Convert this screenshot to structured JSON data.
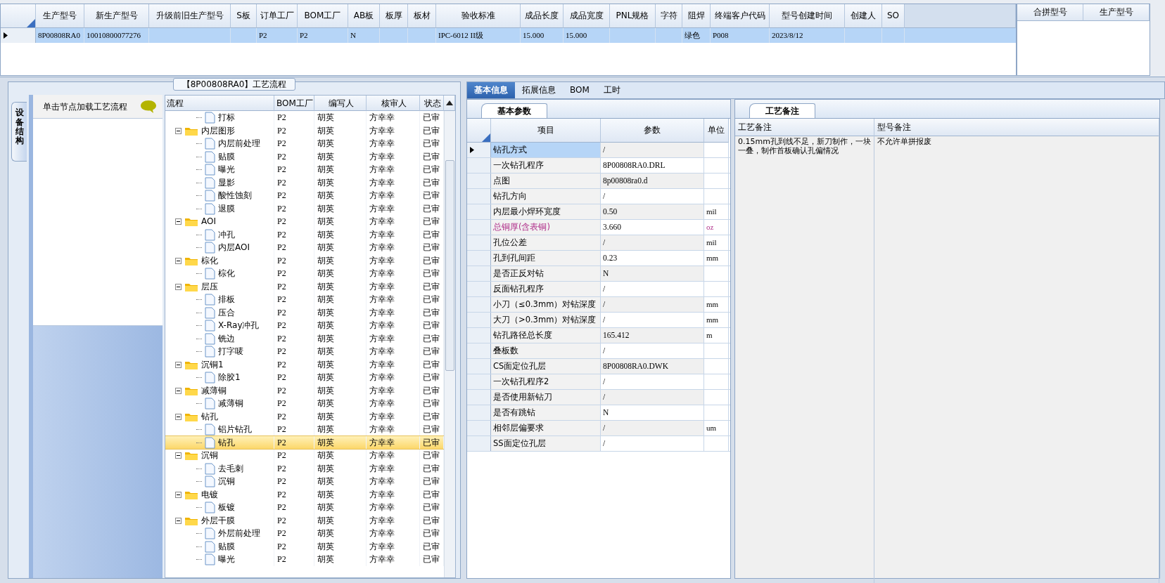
{
  "product_grid": {
    "columns": [
      "生产型号",
      "新生产型号",
      "升级前旧生产型号",
      "S板",
      "订单工厂",
      "BOM工厂",
      "AB板",
      "板厚",
      "板材",
      "验收标准",
      "成品长度",
      "成品宽度",
      "PNL规格",
      "字符",
      "阻焊",
      "终端客户代码",
      "型号创建时间",
      "创建人",
      "SO"
    ],
    "rows": [
      {
        "selected": true,
        "cells": [
          "8P00808RA0",
          "10010800077276",
          null,
          null,
          "P2",
          "P2",
          "N",
          null,
          null,
          "IPC-6012 II级",
          "15.000",
          "15.000",
          null,
          null,
          "绿色",
          "P008",
          "2023/8/12",
          null,
          null
        ]
      }
    ]
  },
  "merge_grid": {
    "columns": [
      "合拼型号",
      "生产型号"
    ]
  },
  "process_panel": {
    "title": "【8P00808RA0】工艺流程",
    "side_tab": "设备结构",
    "hint": "单击节点加载工艺流程",
    "tree": {
      "columns": [
        "流程",
        "BOM工厂",
        "编写人",
        "核审人",
        "状态"
      ],
      "nodes": [
        {
          "kind": "continued",
          "children": [
            {
              "label": "打标",
              "bom": "P2",
              "writer": "胡英",
              "reviewer": "方幸幸",
              "status": "已审",
              "selected": false
            }
          ]
        },
        {
          "kind": "folder",
          "label": "内层图形",
          "bom": "P2",
          "writer": "胡英",
          "reviewer": "方幸幸",
          "status": "已审",
          "selected": false,
          "expanded": true,
          "children": [
            {
              "label": "内层前处理",
              "bom": "P2",
              "writer": "胡英",
              "reviewer": "方幸幸",
              "status": "已审",
              "selected": false
            },
            {
              "label": "贴膜",
              "bom": "P2",
              "writer": "胡英",
              "reviewer": "方幸幸",
              "status": "已审",
              "selected": false
            },
            {
              "label": "曝光",
              "bom": "P2",
              "writer": "胡英",
              "reviewer": "方幸幸",
              "status": "已审",
              "selected": false
            },
            {
              "label": "显影",
              "bom": "P2",
              "writer": "胡英",
              "reviewer": "方幸幸",
              "status": "已审",
              "selected": false
            },
            {
              "label": "酸性蚀刻",
              "bom": "P2",
              "writer": "胡英",
              "reviewer": "方幸幸",
              "status": "已审",
              "selected": false
            },
            {
              "label": "退膜",
              "bom": "P2",
              "writer": "胡英",
              "reviewer": "方幸幸",
              "status": "已审",
              "selected": false
            }
          ]
        },
        {
          "kind": "folder",
          "label": "AOI",
          "bom": "P2",
          "writer": "胡英",
          "reviewer": "方幸幸",
          "status": "已审",
          "selected": false,
          "expanded": true,
          "children": [
            {
              "label": "冲孔",
              "bom": "P2",
              "writer": "胡英",
              "reviewer": "方幸幸",
              "status": "已审",
              "selected": false
            },
            {
              "label": "内层AOI",
              "bom": "P2",
              "writer": "胡英",
              "reviewer": "方幸幸",
              "status": "已审",
              "selected": false
            }
          ]
        },
        {
          "kind": "folder",
          "label": "棕化",
          "bom": "P2",
          "writer": "胡英",
          "reviewer": "方幸幸",
          "status": "已审",
          "selected": false,
          "expanded": true,
          "children": [
            {
              "label": "棕化",
              "bom": "P2",
              "writer": "胡英",
              "reviewer": "方幸幸",
              "status": "已审",
              "selected": false
            }
          ]
        },
        {
          "kind": "folder",
          "label": "层压",
          "bom": "P2",
          "writer": "胡英",
          "reviewer": "方幸幸",
          "status": "已审",
          "selected": false,
          "expanded": true,
          "children": [
            {
              "label": "排板",
              "bom": "P2",
              "writer": "胡英",
              "reviewer": "方幸幸",
              "status": "已审",
              "selected": false
            },
            {
              "label": "压合",
              "bom": "P2",
              "writer": "胡英",
              "reviewer": "方幸幸",
              "status": "已审",
              "selected": false
            },
            {
              "label": "X-Ray冲孔",
              "bom": "P2",
              "writer": "胡英",
              "reviewer": "方幸幸",
              "status": "已审",
              "selected": false
            },
            {
              "label": "铣边",
              "bom": "P2",
              "writer": "胡英",
              "reviewer": "方幸幸",
              "status": "已审",
              "selected": false
            },
            {
              "label": "打字唛",
              "bom": "P2",
              "writer": "胡英",
              "reviewer": "方幸幸",
              "status": "已审",
              "selected": false
            }
          ]
        },
        {
          "kind": "folder",
          "label": "沉铜1",
          "bom": "P2",
          "writer": "胡英",
          "reviewer": "方幸幸",
          "status": "已审",
          "selected": false,
          "expanded": true,
          "children": [
            {
              "label": "除胶1",
              "bom": "P2",
              "writer": "胡英",
              "reviewer": "方幸幸",
              "status": "已审",
              "selected": false
            }
          ]
        },
        {
          "kind": "folder",
          "label": "减薄铜",
          "bom": "P2",
          "writer": "胡英",
          "reviewer": "方幸幸",
          "status": "已审",
          "selected": false,
          "expanded": true,
          "children": [
            {
              "label": "减薄铜",
              "bom": "P2",
              "writer": "胡英",
              "reviewer": "方幸幸",
              "status": "已审",
              "selected": false
            }
          ]
        },
        {
          "kind": "folder",
          "label": "钻孔",
          "bom": "P2",
          "writer": "胡英",
          "reviewer": "方幸幸",
          "status": "已审",
          "selected": false,
          "expanded": true,
          "children": [
            {
              "label": "铝片钻孔",
              "bom": "P2",
              "writer": "胡英",
              "reviewer": "方幸幸",
              "status": "已审",
              "selected": false
            },
            {
              "label": "钻孔",
              "bom": "P2",
              "writer": "胡英",
              "reviewer": "方幸幸",
              "status": "已审",
              "selected": true
            }
          ]
        },
        {
          "kind": "folder",
          "label": "沉铜",
          "bom": "P2",
          "writer": "胡英",
          "reviewer": "方幸幸",
          "status": "已审",
          "selected": false,
          "expanded": true,
          "children": [
            {
              "label": "去毛刺",
              "bom": "P2",
              "writer": "胡英",
              "reviewer": "方幸幸",
              "status": "已审",
              "selected": false
            },
            {
              "label": "沉铜",
              "bom": "P2",
              "writer": "胡英",
              "reviewer": "方幸幸",
              "status": "已审",
              "selected": false
            }
          ]
        },
        {
          "kind": "folder",
          "label": "电镀",
          "bom": "P2",
          "writer": "胡英",
          "reviewer": "方幸幸",
          "status": "已审",
          "selected": false,
          "expanded": true,
          "children": [
            {
              "label": "板镀",
              "bom": "P2",
              "writer": "胡英",
              "reviewer": "方幸幸",
              "status": "已审",
              "selected": false
            }
          ]
        },
        {
          "kind": "folder",
          "label": "外层干膜",
          "bom": "P2",
          "writer": "胡英",
          "reviewer": "方幸幸",
          "status": "已审",
          "selected": false,
          "expanded": true,
          "children": [
            {
              "label": "外层前处理",
              "bom": "P2",
              "writer": "胡英",
              "reviewer": "方幸幸",
              "status": "已审",
              "selected": false
            },
            {
              "label": "贴膜",
              "bom": "P2",
              "writer": "胡英",
              "reviewer": "方幸幸",
              "status": "已审",
              "selected": false
            },
            {
              "label": "曝光",
              "bom": "P2",
              "writer": "胡英",
              "reviewer": "方幸幸",
              "status": "已审",
              "selected": false
            }
          ]
        }
      ]
    }
  },
  "detail_tabs": [
    {
      "label": "基本信息",
      "selected": true
    },
    {
      "label": "拓展信息",
      "selected": false
    },
    {
      "label": "BOM",
      "selected": false
    },
    {
      "label": "工时",
      "selected": false
    }
  ],
  "params": {
    "tab": "基本参数",
    "columns": [
      "项目",
      "参数",
      "单位"
    ],
    "rows": [
      {
        "item": "钻孔方式",
        "value": "/",
        "unit": null,
        "selected": true,
        "flagged": false
      },
      {
        "item": "一次钻孔程序",
        "value": "8P00808RA0.DRL",
        "unit": null,
        "selected": false,
        "flagged": false
      },
      {
        "item": "点图",
        "value": "8p00808ra0.d",
        "unit": null,
        "selected": false,
        "flagged": false
      },
      {
        "item": "钻孔方向",
        "value": "/",
        "unit": null,
        "selected": false,
        "flagged": false
      },
      {
        "item": "内层最小焊环宽度",
        "value": "0.50",
        "unit": "mil",
        "selected": false,
        "flagged": false
      },
      {
        "item": "总铜厚(含表铜)",
        "value": "3.660",
        "unit": "oz",
        "selected": false,
        "flagged": true
      },
      {
        "item": "孔位公差",
        "value": "/",
        "unit": "mil",
        "selected": false,
        "flagged": false
      },
      {
        "item": "孔到孔间距",
        "value": "0.23",
        "unit": "mm",
        "selected": false,
        "flagged": false
      },
      {
        "item": "是否正反对钻",
        "value": "N",
        "unit": null,
        "selected": false,
        "flagged": false
      },
      {
        "item": "反面钻孔程序",
        "value": "/",
        "unit": null,
        "selected": false,
        "flagged": false
      },
      {
        "item": "小刀（≤0.3mm）对钻深度",
        "value": "/",
        "unit": "mm",
        "selected": false,
        "flagged": false
      },
      {
        "item": "大刀（>0.3mm）对钻深度",
        "value": "/",
        "unit": "mm",
        "selected": false,
        "flagged": false
      },
      {
        "item": "钻孔路径总长度",
        "value": "165.412",
        "unit": "m",
        "selected": false,
        "flagged": false
      },
      {
        "item": "叠板数",
        "value": "/",
        "unit": null,
        "selected": false,
        "flagged": false
      },
      {
        "item": "CS面定位孔层",
        "value": "8P00808RA0.DWK",
        "unit": null,
        "selected": false,
        "flagged": false
      },
      {
        "item": "一次钻孔程序2",
        "value": "/",
        "unit": null,
        "selected": false,
        "flagged": false
      },
      {
        "item": "是否使用新钻刀",
        "value": "/",
        "unit": null,
        "selected": false,
        "flagged": false
      },
      {
        "item": "是否有跳钻",
        "value": "N",
        "unit": null,
        "selected": false,
        "flagged": false
      },
      {
        "item": "相邻层偏要求",
        "value": "/",
        "unit": "um",
        "selected": false,
        "flagged": false
      },
      {
        "item": "SS面定位孔层",
        "value": "/",
        "unit": null,
        "selected": false,
        "flagged": false
      }
    ]
  },
  "notes": {
    "tab": "工艺备注",
    "columns": [
      "工艺备注",
      "型号备注"
    ],
    "values": [
      "0.15mm孔到线不足，新刀制作，一块一叠，制作首板确认孔偏情况",
      "不允许单拼报废"
    ]
  }
}
